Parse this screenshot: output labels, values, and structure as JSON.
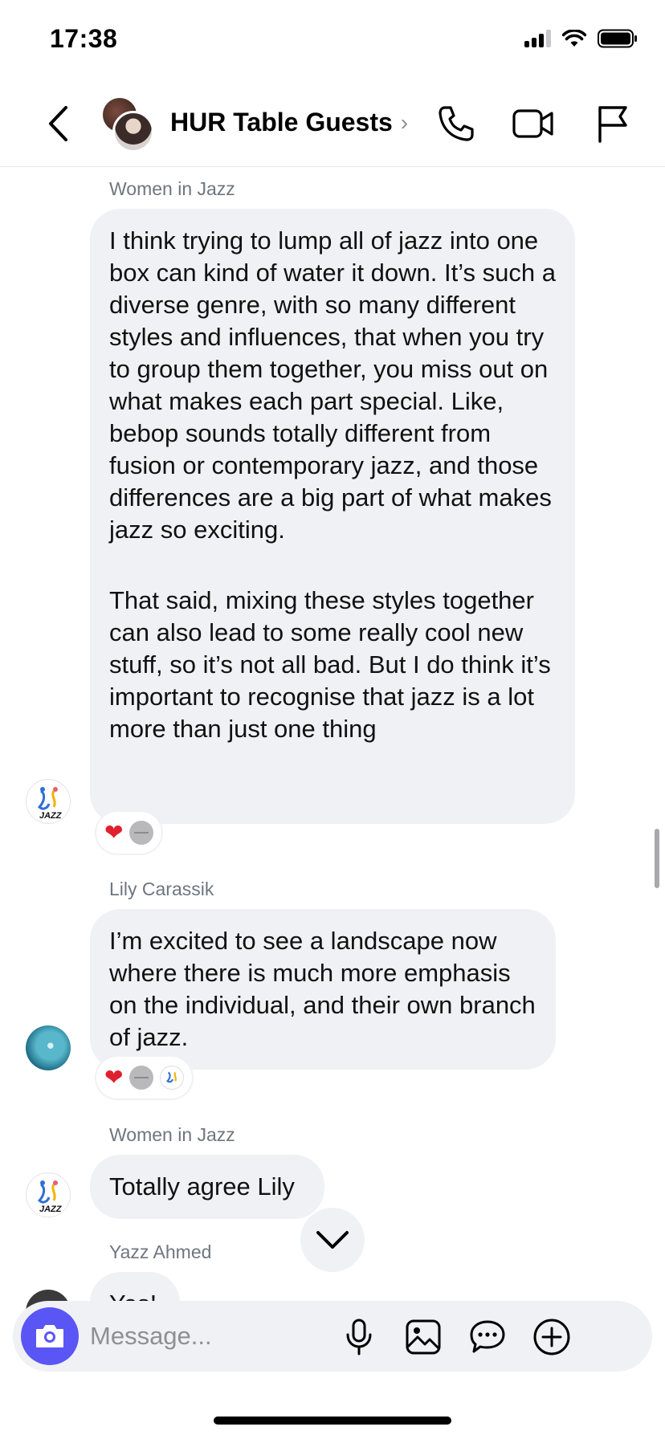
{
  "status_bar": {
    "time": "17:38"
  },
  "header": {
    "title": "HUR Table Guests"
  },
  "messages": [
    {
      "sender": "Women in Jazz",
      "paragraphs": [
        "I think trying to lump all of jazz into one box can kind of water it down. It’s such a diverse genre, with so many different styles and influences, that when you try to group them together, you miss out on what makes each part special. Like, bebop sounds totally different from fusion or contemporary jazz, and those differences are a big part of what makes jazz so exciting.",
        "That said, mixing these styles together can also lead to some really cool new stuff, so it’s not all bad. But I do think it’s important to recognise that jazz is a lot more than just one thing"
      ],
      "reactions": [
        "heart",
        "grey"
      ]
    },
    {
      "sender": "Lily Carassik",
      "paragraphs": [
        "I’m excited to see a landscape now where there is much more emphasis on the individual, and their own branch of jazz."
      ],
      "reactions": [
        "heart",
        "grey",
        "women-in-jazz"
      ]
    },
    {
      "sender": "Women in Jazz",
      "paragraphs": [
        "Totally agree Lily"
      ]
    },
    {
      "sender": "Yazz Ahmed",
      "paragraphs": [
        "Yes!"
      ]
    }
  ],
  "composer": {
    "placeholder": "Message..."
  },
  "colors": {
    "accent": "#5a55f5",
    "bubble": "#f0f1f4",
    "heart": "#e0202d"
  }
}
